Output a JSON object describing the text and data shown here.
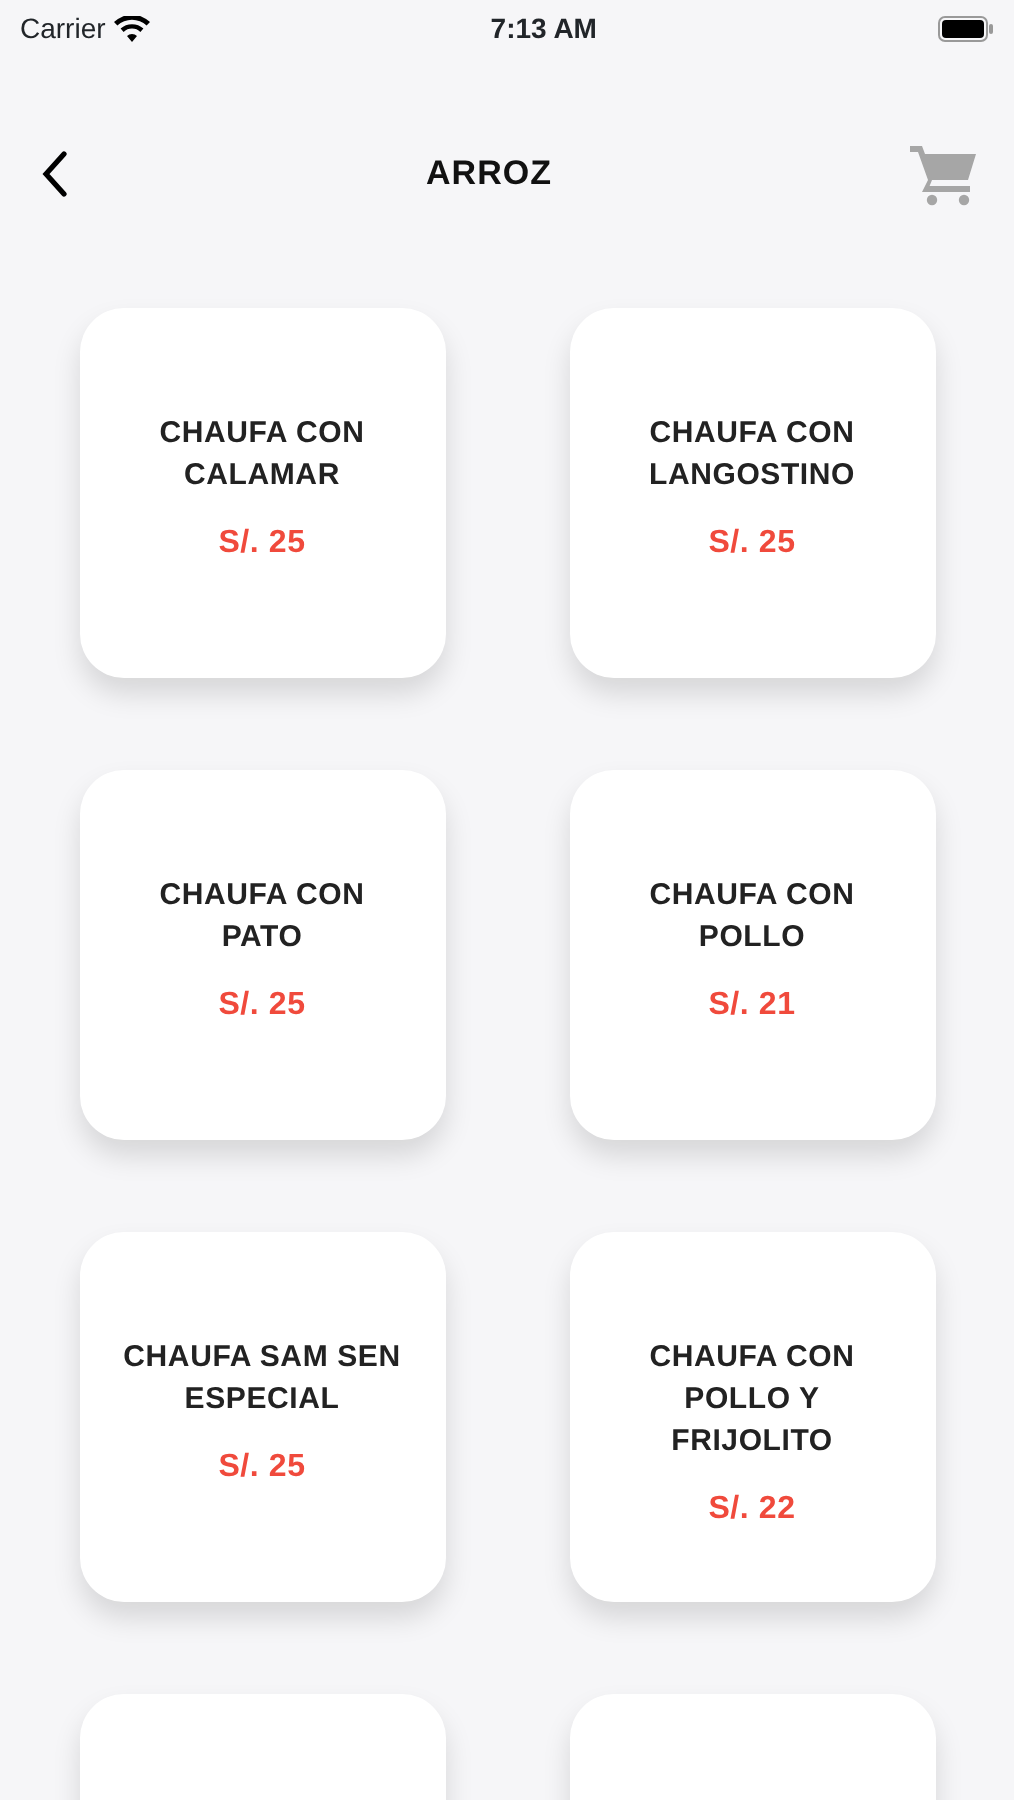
{
  "status_bar": {
    "carrier": "Carrier",
    "time": "7:13 AM"
  },
  "nav": {
    "title": "ARROZ"
  },
  "items": [
    {
      "kind": "dish",
      "name": "CHAUFA CON CALAMAR",
      "price": "S/. 25"
    },
    {
      "kind": "dish",
      "name": "CHAUFA CON LANGOSTINO",
      "price": "S/. 25"
    },
    {
      "kind": "dish",
      "name": "CHAUFA CON PATO",
      "price": "S/. 25"
    },
    {
      "kind": "dish",
      "name": "CHAUFA CON POLLO",
      "price": "S/. 21"
    },
    {
      "kind": "dish",
      "name": "CHAUFA SAM SEN ESPECIAL",
      "price": "S/. 25"
    },
    {
      "kind": "dish",
      "name": "CHAUFA CON POLLO Y FRIJOLITO",
      "price": "S/. 22"
    },
    {
      "kind": "cut"
    },
    {
      "kind": "cut"
    }
  ]
}
